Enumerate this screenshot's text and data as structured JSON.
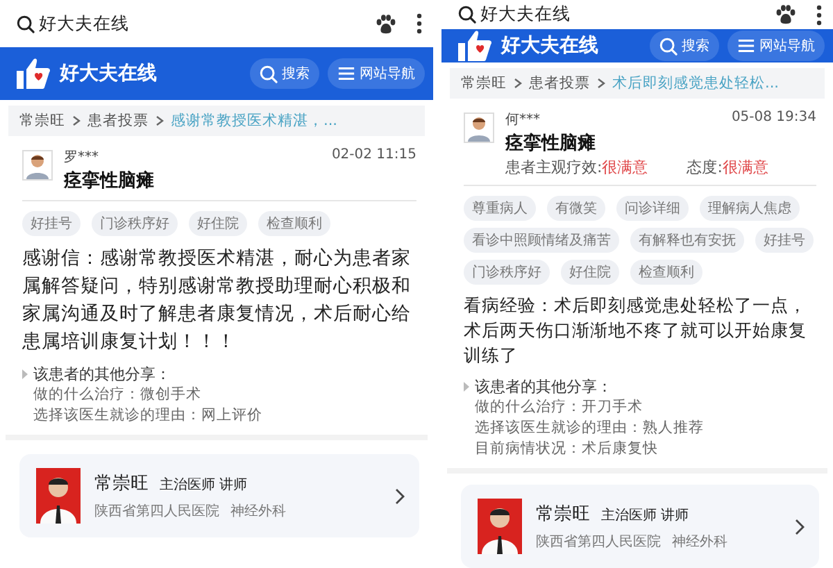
{
  "panels": [
    {
      "search_query": "好大夫在线",
      "site_name": "好大夫在线",
      "header_buttons": [
        {
          "kind": "search",
          "label": "搜索"
        },
        {
          "kind": "menu",
          "label": "网站导航"
        }
      ],
      "breadcrumb": [
        {
          "label": "常崇旺",
          "current": false
        },
        {
          "label": "患者投票",
          "current": false
        },
        {
          "label": "感谢常教授医术精湛，...",
          "current": true
        }
      ],
      "review": {
        "user": "罗***",
        "time": "02-02 11:15",
        "disease": "痉挛性脑瘫",
        "tags": [
          "好挂号",
          "门诊秩序好",
          "好住院",
          "检查顺利"
        ],
        "body": "感谢信：感谢常教授医术精湛，耐心为患者家属解答疑问，特别感谢常教授助理耐心积极和家属沟通及时了解患者康复情况，术后耐心给患属培训康复计划！！！",
        "shares_title": "该患者的其他分享：",
        "shares": [
          "做的什么治疗：微创手术",
          "选择该医生就诊的理由：网上评价"
        ]
      },
      "doctor": {
        "name": "常崇旺",
        "title": "主治医师 讲师",
        "hospital": "陕西省第四人民医院",
        "department": "神经外科"
      }
    },
    {
      "search_query": "好大夫在线",
      "site_name": "好大夫在线",
      "header_buttons": [
        {
          "kind": "search",
          "label": "搜索"
        },
        {
          "kind": "menu",
          "label": "网站导航"
        }
      ],
      "breadcrumb": [
        {
          "label": "常崇旺",
          "current": false
        },
        {
          "label": "患者投票",
          "current": false
        },
        {
          "label": "术后即刻感觉患处轻松...",
          "current": true
        }
      ],
      "review": {
        "user": "何***",
        "time": "05-08 19:34",
        "disease": "痉挛性脑瘫",
        "ratings": [
          {
            "label": "患者主观疗效:",
            "value": "很满意"
          },
          {
            "label": "态度:",
            "value": "很满意"
          }
        ],
        "tags": [
          "尊重病人",
          "有微笑",
          "问诊详细",
          "理解病人焦虑",
          "看诊中照顾情绪及痛苦",
          "有解释也有安抚",
          "好挂号",
          "门诊秩序好",
          "好住院",
          "检查顺利"
        ],
        "body": "看病经验：术后即刻感觉患处轻松了一点，术后两天伤口渐渐地不疼了就可以开始康复训练了",
        "shares_title": "该患者的其他分享：",
        "shares": [
          "做的什么治疗：开刀手术",
          "选择该医生就诊的理由：熟人推荐",
          "目前病情状况：术后康复快"
        ]
      },
      "doctor": {
        "name": "常崇旺",
        "title": "主治医师 讲师",
        "hospital": "陕西省第四人民医院",
        "department": "神经外科"
      }
    }
  ]
}
